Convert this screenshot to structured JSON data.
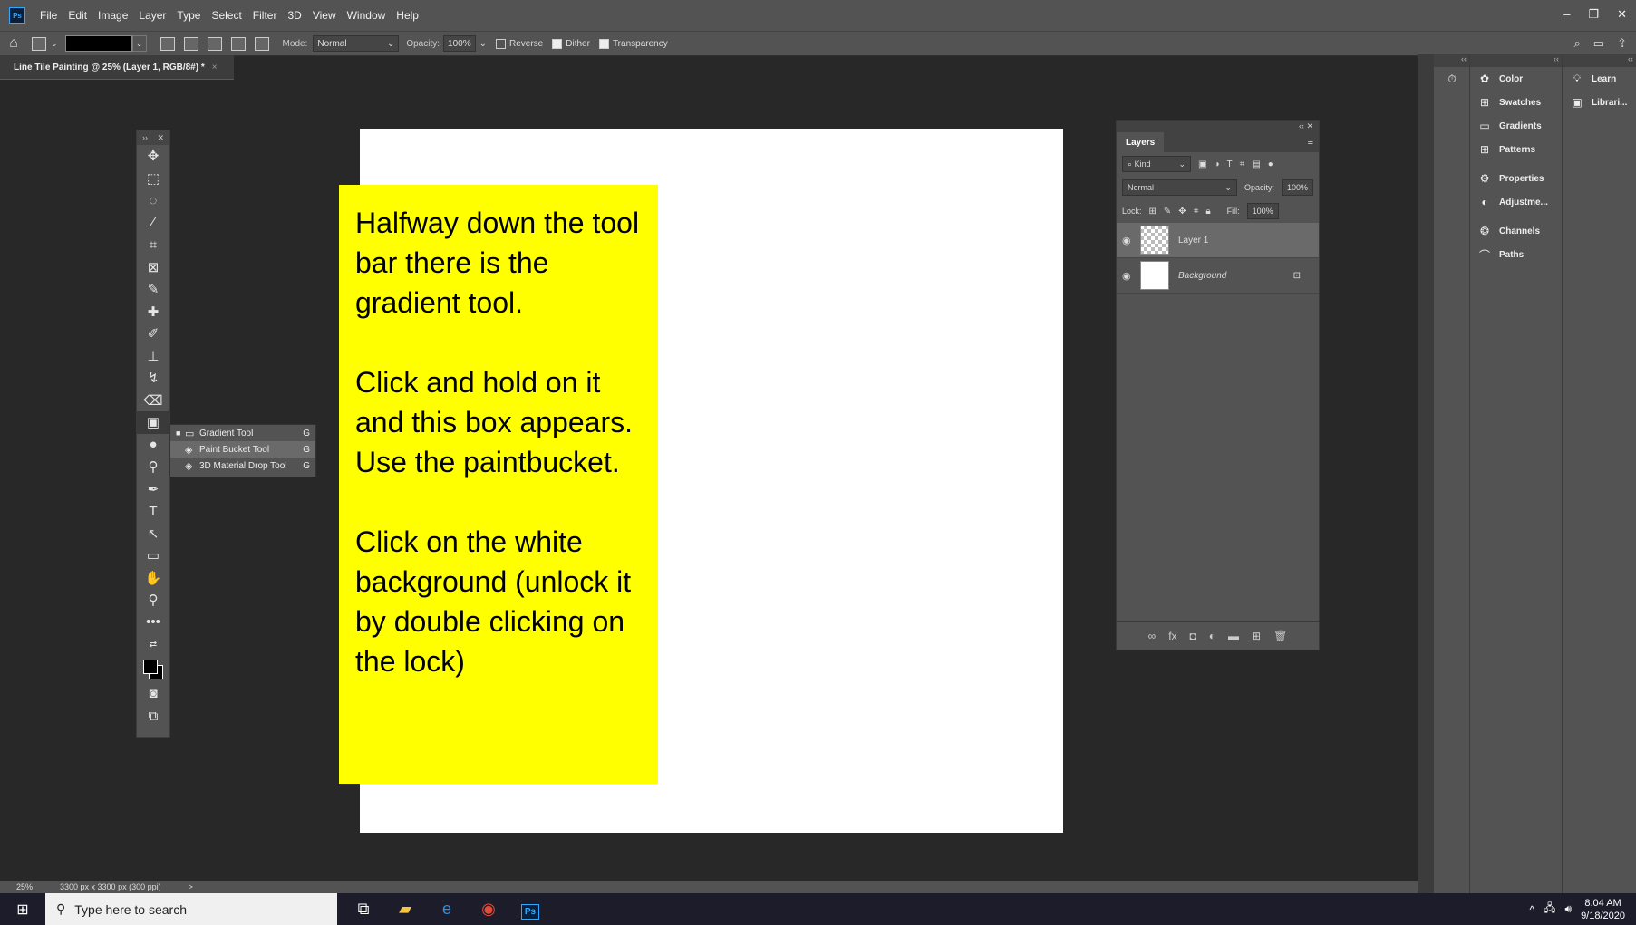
{
  "menubar": {
    "logo": "Ps",
    "items": [
      "File",
      "Edit",
      "Image",
      "Layer",
      "Type",
      "Select",
      "Filter",
      "3D",
      "View",
      "Window",
      "Help"
    ]
  },
  "optbar": {
    "mode_label": "Mode:",
    "mode_value": "Normal",
    "opacity_label": "Opacity:",
    "opacity_value": "100%",
    "reverse": "Reverse",
    "dither": "Dither",
    "transparency": "Transparency"
  },
  "doc_tab": {
    "title": "Line Tile Painting @ 25% (Layer 1, RGB/8#) *",
    "close": "×"
  },
  "note": {
    "p1": "Halfway down the tool bar there is the gradient tool.",
    "p2": "Click and hold on it and this box appears. Use the paintbucket.",
    "p3": "Click on the white background (unlock it by double clicking on the lock)"
  },
  "flyout": {
    "items": [
      {
        "label": "Gradient Tool",
        "key": "G"
      },
      {
        "label": "Paint Bucket Tool",
        "key": "G"
      },
      {
        "label": "3D Material Drop Tool",
        "key": "G"
      }
    ]
  },
  "layers_panel": {
    "tab": "Layers",
    "kind": "Kind",
    "blend": "Normal",
    "opacity_label": "Opacity:",
    "opacity_value": "100%",
    "lock_label": "Lock:",
    "fill_label": "Fill:",
    "fill_value": "100%",
    "layers": [
      {
        "name": "Layer 1"
      },
      {
        "name": "Background"
      }
    ]
  },
  "right_panels": {
    "group1": [
      "Color",
      "Swatches",
      "Gradients",
      "Patterns"
    ],
    "group2": [
      "Properties",
      "Adjustme..."
    ],
    "group3": [
      "Channels",
      "Paths"
    ],
    "group4": [
      "Learn",
      "Librari..."
    ]
  },
  "statusbar": {
    "zoom": "25%",
    "doc_size": "3300 px x 3300 px (300 ppi)",
    "arrow": ">"
  },
  "taskbar": {
    "search_placeholder": "Type here to search",
    "time": "8:04 AM",
    "date": "9/18/2020"
  }
}
